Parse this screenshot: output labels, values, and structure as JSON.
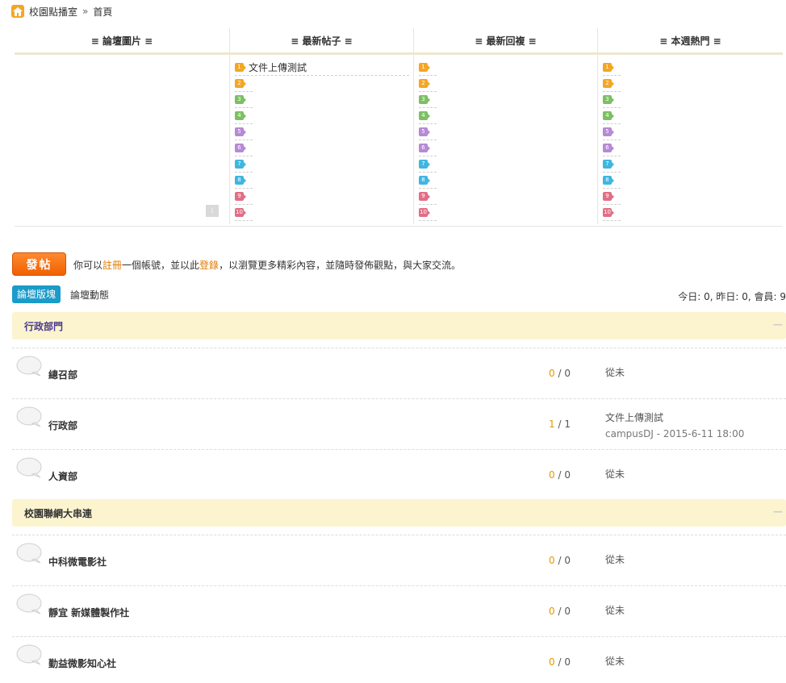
{
  "breadcrumb": {
    "site": "校園點播室",
    "sep": "»",
    "current": "首頁"
  },
  "portal": {
    "headers": [
      "≡ 論壇圖片 ≡",
      "≡ 最新帖子 ≡",
      "≡ 最新回複 ≡",
      "≡ 本週熱門 ≡"
    ],
    "latest_posts": [
      "文件上傳測試"
    ],
    "ranks": [
      "1",
      "2",
      "3",
      "4",
      "5",
      "6",
      "7",
      "8",
      "9",
      "10"
    ],
    "rank_colors": [
      "#f5a623",
      "#f5a623",
      "#7cc063",
      "#7cc063",
      "#b58ad6",
      "#b58ad6",
      "#3fb6e0",
      "#3fb6e0",
      "#e06f86",
      "#e06f86"
    ],
    "slide_button": "ⅰ"
  },
  "post_button": "發帖",
  "notice": {
    "a": "你可以",
    "register": "註冊",
    "b": "一個帳號，並以此",
    "login": "登錄",
    "c": "，以瀏覽更多精彩內容，並隨時發佈觀點，與大家交流。"
  },
  "tabs": {
    "boards": "論壇版塊",
    "activity": "論壇動態"
  },
  "stats": "今日: 0, 昨日: 0, 會員: 9",
  "categories": [
    {
      "title": "行政部門",
      "collapse": "—"
    },
    {
      "title": "校園聯網大串連",
      "collapse": "—"
    }
  ],
  "forums": [
    {
      "name": "總召部",
      "threads": "0",
      "posts": "0",
      "last": "從未",
      "last_meta": ""
    },
    {
      "name": "行政部",
      "threads": "1",
      "posts": "1",
      "last": "文件上傳測試",
      "last_meta": "campusDJ - 2015-6-11 18:00"
    },
    {
      "name": "人資部",
      "threads": "0",
      "posts": "0",
      "last": "從未",
      "last_meta": ""
    },
    {
      "name": "中科微電影社",
      "threads": "0",
      "posts": "0",
      "last": "從未",
      "last_meta": ""
    },
    {
      "name": "靜宜 新媒體製作社",
      "threads": "0",
      "posts": "0",
      "last": "從未",
      "last_meta": ""
    },
    {
      "name": "勤益微影知心社",
      "threads": "0",
      "posts": "0",
      "last": "從未",
      "last_meta": ""
    }
  ],
  "count_sep": "/"
}
